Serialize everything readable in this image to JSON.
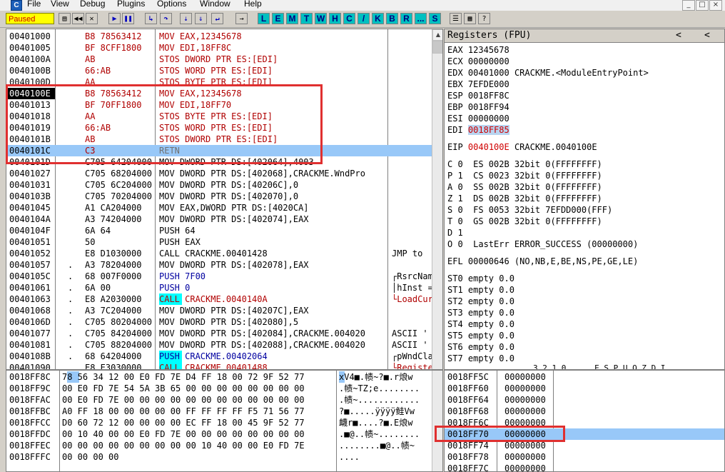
{
  "app": {
    "menu": [
      "File",
      "View",
      "Debug",
      "Plugins",
      "Options",
      "Window",
      "Help"
    ],
    "app_icon_letter": "C",
    "window_buttons": [
      "_",
      "□",
      "×"
    ]
  },
  "toolbar": {
    "status": "Paused",
    "letter_buttons": [
      "L",
      "E",
      "M",
      "T",
      "W",
      "H",
      "C",
      "/",
      "K",
      "B",
      "R",
      "...",
      "S"
    ]
  },
  "disasm": {
    "rows": [
      {
        "addr": "00401000",
        "m": "",
        "hex": "B8 78563412",
        "ins": "MOV EAX,12345678",
        "cmt": ""
      },
      {
        "addr": "00401005",
        "m": "",
        "hex": "BF 8CFF1800",
        "ins": "MOV EDI,18FF8C",
        "cmt": ""
      },
      {
        "addr": "0040100A",
        "m": "",
        "hex": "AB",
        "ins": "STOS DWORD PTR ES:[EDI]",
        "cmt": ""
      },
      {
        "addr": "0040100B",
        "m": "",
        "hex": "66:AB",
        "ins": "STOS WORD PTR ES:[EDI]",
        "cmt": ""
      },
      {
        "addr": "0040100D",
        "m": "",
        "hex": "AA",
        "ins": "STOS BYTE PTR ES:[EDI]",
        "cmt": ""
      },
      {
        "addr": "0040100E",
        "m": "",
        "hex": "B8 78563412",
        "ins": "MOV EAX,12345678",
        "cmt": ""
      },
      {
        "addr": "00401013",
        "m": "",
        "hex": "BF 70FF1800",
        "ins": "MOV EDI,18FF70",
        "cmt": ""
      },
      {
        "addr": "00401018",
        "m": "",
        "hex": "AA",
        "ins": "STOS BYTE PTR ES:[EDI]",
        "cmt": ""
      },
      {
        "addr": "00401019",
        "m": "",
        "hex": "66:AB",
        "ins": "STOS WORD PTR ES:[EDI]",
        "cmt": ""
      },
      {
        "addr": "0040101B",
        "m": "",
        "hex": "AB",
        "ins": "STOS DWORD PTR ES:[EDI]",
        "cmt": ""
      },
      {
        "addr": "0040101C",
        "m": "",
        "hex": "C3",
        "ins": "RETN",
        "cmt": ""
      },
      {
        "addr": "0040101D",
        "m": "",
        "hex": "C705 64204000",
        "ins": "MOV DWORD PTR DS:[402064],4003",
        "cmt": ""
      },
      {
        "addr": "00401027",
        "m": "",
        "hex": "C705 68204000",
        "ins": "MOV DWORD PTR DS:[402068],CRACKME.WndPro",
        "cmt": ""
      },
      {
        "addr": "00401031",
        "m": "",
        "hex": "C705 6C204000",
        "ins": "MOV DWORD PTR DS:[40206C],0",
        "cmt": ""
      },
      {
        "addr": "0040103B",
        "m": "",
        "hex": "C705 70204000",
        "ins": "MOV DWORD PTR DS:[402070],0",
        "cmt": ""
      },
      {
        "addr": "00401045",
        "m": "",
        "hex": "A1 CA204000",
        "ins": "MOV EAX,DWORD PTR DS:[4020CA]",
        "cmt": ""
      },
      {
        "addr": "0040104A",
        "m": "",
        "hex": "A3 74204000",
        "ins": "MOV DWORD PTR DS:[402074],EAX",
        "cmt": ""
      },
      {
        "addr": "0040104F",
        "m": "",
        "hex": "6A 64",
        "ins": "PUSH 64",
        "cmt": ""
      },
      {
        "addr": "00401051",
        "m": "",
        "hex": "50",
        "ins": "PUSH EAX",
        "cmt": ""
      },
      {
        "addr": "00401052",
        "m": "",
        "hex": "E8 D1030000",
        "ins": "CALL CRACKME.00401428",
        "cmt": "JMP to"
      },
      {
        "addr": "00401057",
        "m": ".",
        "hex": "A3 78204000",
        "ins": "MOV DWORD PTR DS:[402078],EAX",
        "cmt": ""
      },
      {
        "addr": "0040105C",
        "m": ".",
        "hex": "68 007F0000",
        "ins": "PUSH 7F00",
        "cmt": "┌RsrcNam"
      },
      {
        "addr": "00401061",
        "m": ".",
        "hex": "6A 00",
        "ins": "PUSH 0",
        "cmt": "│hInst ="
      },
      {
        "addr": "00401063",
        "m": ".",
        "hex": "E8 A2030000",
        "ins": "CALL CRACKME.0040140A",
        "cmt": "└LoadCur"
      },
      {
        "addr": "00401068",
        "m": ".",
        "hex": "A3 7C204000",
        "ins": "MOV DWORD PTR DS:[40207C],EAX",
        "cmt": ""
      },
      {
        "addr": "0040106D",
        "m": ".",
        "hex": "C705 80204000",
        "ins": "MOV DWORD PTR DS:[402080],5",
        "cmt": ""
      },
      {
        "addr": "00401077",
        "m": ".",
        "hex": "C705 84204000",
        "ins": "MOV DWORD PTR DS:[402084],CRACKME.004020",
        "cmt": "ASCII '"
      },
      {
        "addr": "00401081",
        "m": ".",
        "hex": "C705 88204000",
        "ins": "MOV DWORD PTR DS:[402088],CRACKME.004020",
        "cmt": "ASCII '"
      },
      {
        "addr": "0040108B",
        "m": ".",
        "hex": "68 64204000",
        "ins": "PUSH CRACKME.00402064",
        "cmt": "┌pWndCla"
      },
      {
        "addr": "00401090",
        "m": ".",
        "hex": "E8 E3030000",
        "ins": "CALL CRACKME.00401488",
        "cmt": "└Registe"
      }
    ]
  },
  "registers": {
    "title": "Registers (FPU)",
    "nav_buttons": [
      "<",
      "<"
    ],
    "gpr": [
      {
        "name": "EAX",
        "val": "12345678",
        "extra": ""
      },
      {
        "name": "ECX",
        "val": "00000000",
        "extra": ""
      },
      {
        "name": "EDX",
        "val": "00401000",
        "extra": "CRACKME.<ModuleEntryPoint>"
      },
      {
        "name": "EBX",
        "val": "7EFDE000",
        "extra": ""
      },
      {
        "name": "ESP",
        "val": "0018FF8C",
        "extra": ""
      },
      {
        "name": "EBP",
        "val": "0018FF94",
        "extra": ""
      },
      {
        "name": "ESI",
        "val": "00000000",
        "extra": ""
      },
      {
        "name": "EDI",
        "val": "0018FF85",
        "extra": ""
      }
    ],
    "eip": {
      "name": "EIP",
      "val": "0040100E",
      "extra": "CRACKME.0040100E"
    },
    "flags": [
      "C 0  ES 002B 32bit 0(FFFFFFFF)",
      "P 1  CS 0023 32bit 0(FFFFFFFF)",
      "A 0  SS 002B 32bit 0(FFFFFFFF)",
      "Z 1  DS 002B 32bit 0(FFFFFFFF)",
      "S 0  FS 0053 32bit 7EFDD000(FFF)",
      "T 0  GS 002B 32bit 0(FFFFFFFF)",
      "D 1",
      "O 0  LastErr ERROR_SUCCESS (00000000)"
    ],
    "efl": "EFL 00000646 (NO,NB,E,BE,NS,PE,GE,LE)",
    "fpu": [
      "ST0 empty 0.0",
      "ST1 empty 0.0",
      "ST2 empty 0.0",
      "ST3 empty 0.0",
      "ST4 empty 0.0",
      "ST5 empty 0.0",
      "ST6 empty 0.0",
      "ST7 empty 0.0"
    ],
    "bits": "3 2 1 0      E S P U O Z D I"
  },
  "dump": {
    "rows": [
      {
        "addr": "0018FF8C",
        "hex": "78 56 34 12 00 E0 FD 7E D4 FF 18 00 72 9F 52 77",
        "ascii": "xV4■.帻~?■.r烺w"
      },
      {
        "addr": "0018FF9C",
        "hex": "00 E0 FD 7E 54 5A 3B 65 00 00 00 00 00 00 00 00",
        "ascii": ".帻~TZ;e........"
      },
      {
        "addr": "0018FFAC",
        "hex": "00 E0 FD 7E 00 00 00 00 00 00 00 00 00 00 00 00",
        "ascii": ".帻~............"
      },
      {
        "addr": "0018FFBC",
        "hex": "A0 FF 18 00 00 00 00 00 FF FF FF FF F5 71 56 77",
        "ascii": "?■.....ÿÿÿÿ鲑Vw"
      },
      {
        "addr": "0018FFCC",
        "hex": "D0 60 72 12 00 00 00 00 EC FF 18 00 45 9F 52 77",
        "ascii": "衊r■....?■.E烺w"
      },
      {
        "addr": "0018FFDC",
        "hex": "00 10 40 00 00 E0 FD 7E 00 00 00 00 00 00 00 00",
        "ascii": ".■@..帻~........"
      },
      {
        "addr": "0018FFEC",
        "hex": "00 00 00 00 00 00 00 00 00 10 40 00 00 E0 FD 7E",
        "ascii": "........■@..帻~"
      },
      {
        "addr": "0018FFFC",
        "hex": "00 00 00 00",
        "ascii": "...."
      }
    ]
  },
  "stack": {
    "rows": [
      {
        "addr": "0018FF5C",
        "val": "00000000"
      },
      {
        "addr": "0018FF60",
        "val": "00000000"
      },
      {
        "addr": "0018FF64",
        "val": "00000000"
      },
      {
        "addr": "0018FF68",
        "val": "00000000"
      },
      {
        "addr": "0018FF6C",
        "val": "00000000"
      },
      {
        "addr": "0018FF70",
        "val": "00000000"
      },
      {
        "addr": "0018FF74",
        "val": "00000000"
      },
      {
        "addr": "0018FF78",
        "val": "00000000"
      },
      {
        "addr": "0018FF7C",
        "val": "00000000"
      }
    ]
  },
  "colors": {
    "accent": "#98c8f8",
    "highlight_red": "#e03030",
    "status_yellow": "#ffff00"
  }
}
